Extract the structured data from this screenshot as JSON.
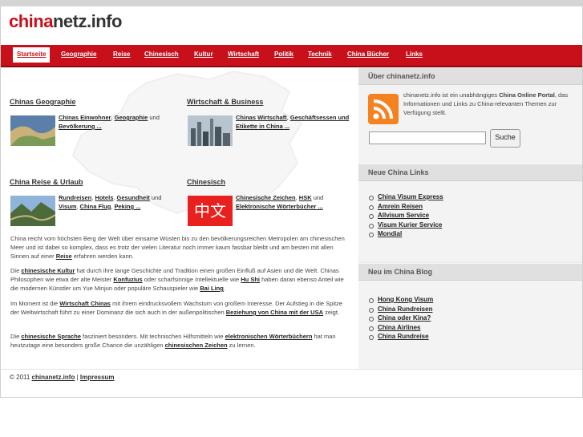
{
  "site": {
    "logo_red": "china",
    "logo_dark": "netz.info"
  },
  "nav": [
    {
      "label": "Startseite",
      "active": true
    },
    {
      "label": "Geographie"
    },
    {
      "label": "Reise"
    },
    {
      "label": "Chinesisch"
    },
    {
      "label": "Kultur"
    },
    {
      "label": "Wirtschaft"
    },
    {
      "label": "Politik"
    },
    {
      "label": "Technik"
    },
    {
      "label": "China Bücher"
    },
    {
      "label": "Links"
    }
  ],
  "sections": {
    "geo": {
      "title": "Chinas Geographie",
      "l1": "Chinas Einwohner",
      "s1": ", ",
      "l2": "Geographie",
      "s2": " und ",
      "l3": "Bevölkerung ..."
    },
    "wirt": {
      "title": "Wirtschaft & Business",
      "l1": "Chinas Wirtschaft",
      "s1": ", ",
      "l2": "Geschäftsessen und Etikette in China ..."
    },
    "reise": {
      "title": "China Reise & Urlaub",
      "l1": "Rundreisen",
      "s1": ", ",
      "l2": "Hotels",
      "s2": ", ",
      "l3": "Gesundheit",
      "s3": " und ",
      "l4": "Visum",
      "s4": ", ",
      "l5": "China Flug",
      "s5": ", ",
      "l6": "Peking ..."
    },
    "chin": {
      "title": "Chinesisch",
      "l1": "Chinesische Zeichen",
      "s1": ", ",
      "l2": "HSK",
      "s2": " und ",
      "l3": "Elektronische Wörterbücher ...",
      "thumb_text": "中文"
    }
  },
  "paragraphs": {
    "p1a": "China reicht vom höchsten Berg der Welt über einsame Wüsten bis zu den bevölkerungsreichen Metropolen am chinesischen Meer und ist dabei so komplex, dass es trotz der vielen Literatur noch immer kaum fassbar bleibt und am besten mit allen Sinnen auf einer ",
    "p1b": "Reise",
    "p1c": " erfahren werden kann.",
    "p2a": "Die ",
    "p2b": "chinesische Kultur",
    "p2c": " hat durch ihre lange Geschichte und Tradition einen großen Einfluß auf Asien und die Welt. Chinas Philosophen wie etwa der alte Meister ",
    "p2d": "Konfuzius",
    "p2e": " oder scharfsinnige Intellektuelle wie ",
    "p2f": "Hu Shi",
    "p2g": " haben daran ebenso Anteil wie die modernen Künstler um Yue Minjun oder populäre Schauspieler wie ",
    "p2h": "Bai Ling",
    "p2i": ".",
    "p3a": "Im Moment ist die ",
    "p3b": "Wirtschaft Chinas",
    "p3c": " mit ihrem eindrucksvollem Wachstum von großem Interesse. Der Aufstieg in die Spitze der Weltwirtschaft führt zu einer Dominanz die sich auch in der außenpolitischen ",
    "p3d": "Beziehung von China mit der USA",
    "p3e": " zeigt.",
    "p4a": "Die ",
    "p4b": "chinesische Sprache",
    "p4c": " fasziniert besonders. Mit technischen Hilfsmitteln wie ",
    "p4d": "elektronischen Wörterbüchern",
    "p4e": " hat man heutzutage eine besonders große Chance die unzähligen ",
    "p4f": "chinesischen Zeichen",
    "p4g": " zu lernen."
  },
  "sidebar": {
    "about_title": "Über chinanetz.info",
    "about_a": "chinanetz.info ist ein unabhängiges ",
    "about_b": "China Online Portal",
    "about_c": ", das Informationen und Links zu China-relevanten Themen zur Verfügung stellt.",
    "search_button": "Suche",
    "search_value": "",
    "links_title": "Neue China Links",
    "links": [
      "China Visum Express",
      "Amrein Reisen",
      "Allvisum Service",
      "Visum Kurier Service",
      "Mondial"
    ],
    "blog_title": "Neu im China Blog",
    "blog": [
      "Hong Kong Visum",
      "China Rundreisen",
      "China oder Kina?",
      "China Airlines",
      "China Rundreise"
    ]
  },
  "footer": {
    "copy": "© 2011 ",
    "site": "chinanetz.info",
    "sep": " | ",
    "impressum": "Impressum"
  },
  "colors": {
    "brand_red": "#c8101b",
    "sidebar_bg": "#ececec",
    "rss_orange": "#f58220"
  }
}
